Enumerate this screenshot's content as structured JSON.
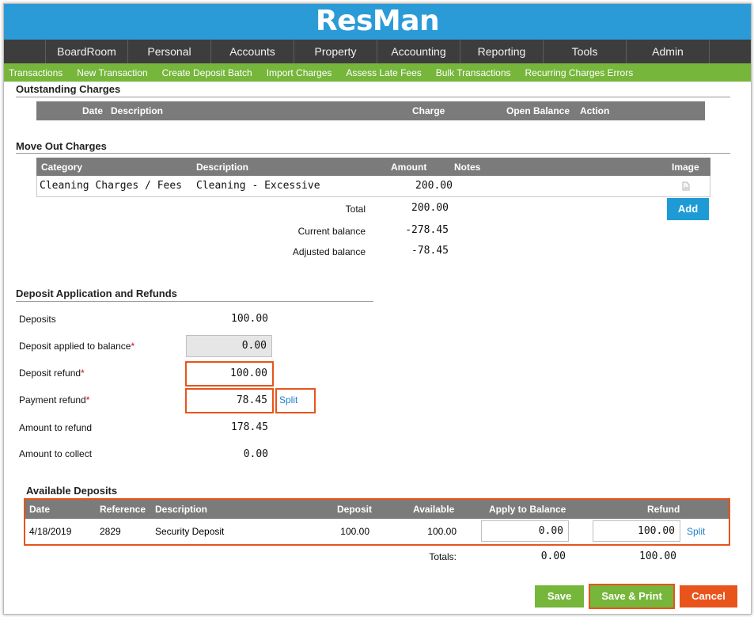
{
  "app": {
    "logo": "ResMan"
  },
  "main_nav": [
    "BoardRoom",
    "Personal",
    "Accounts",
    "Property",
    "Accounting",
    "Reporting",
    "Tools",
    "Admin"
  ],
  "sub_nav": [
    "Transactions",
    "New Transaction",
    "Create Deposit Batch",
    "Import Charges",
    "Assess Late Fees",
    "Bulk Transactions",
    "Recurring Charges Errors"
  ],
  "outstanding": {
    "title": "Outstanding Charges",
    "columns": {
      "date": "Date",
      "description": "Description",
      "charge": "Charge",
      "open_balance": "Open Balance",
      "action": "Action"
    }
  },
  "move_out": {
    "title": "Move Out Charges",
    "columns": {
      "category": "Category",
      "description": "Description",
      "amount": "Amount",
      "notes": "Notes",
      "image": "Image"
    },
    "rows": [
      {
        "category": "Cleaning Charges / Fees",
        "description": "Cleaning - Excessive",
        "amount": "200.00",
        "notes": ""
      }
    ],
    "add_label": "Add",
    "total_label": "Total",
    "total_value": "200.00",
    "current_balance_label": "Current balance",
    "current_balance_value": "-278.45",
    "adjusted_balance_label": "Adjusted balance",
    "adjusted_balance_value": "-78.45"
  },
  "deposit_app": {
    "title": "Deposit Application and Refunds",
    "deposits_label": "Deposits",
    "deposits_value": "100.00",
    "applied_label": "Deposit applied to balance",
    "applied_value": "0.00",
    "deposit_refund_label": "Deposit refund",
    "deposit_refund_value": "100.00",
    "payment_refund_label": "Payment refund",
    "payment_refund_value": "78.45",
    "split_label": "Split",
    "amount_to_refund_label": "Amount to refund",
    "amount_to_refund_value": "178.45",
    "amount_to_collect_label": "Amount to collect",
    "amount_to_collect_value": "0.00",
    "required_mark": "*"
  },
  "available": {
    "title": "Available Deposits",
    "columns": {
      "date": "Date",
      "reference": "Reference",
      "description": "Description",
      "deposit": "Deposit",
      "available": "Available",
      "apply": "Apply to Balance",
      "refund": "Refund"
    },
    "rows": [
      {
        "date": "4/18/2019",
        "reference": "2829",
        "description": "Security Deposit",
        "deposit": "100.00",
        "available": "100.00",
        "apply": "0.00",
        "refund": "100.00",
        "split": "Split"
      }
    ],
    "totals_label": "Totals:",
    "totals_apply": "0.00",
    "totals_refund": "100.00"
  },
  "buttons": {
    "save": "Save",
    "save_print": "Save & Print",
    "cancel": "Cancel"
  },
  "colors": {
    "header": "#2b9bd7",
    "nav": "#3d3d3d",
    "subnav": "#76b63b",
    "grid_header": "#7b7b7b",
    "highlight": "#e8541c",
    "save": "#76b63b",
    "cancel": "#e8541c",
    "add": "#1e9bd7"
  }
}
